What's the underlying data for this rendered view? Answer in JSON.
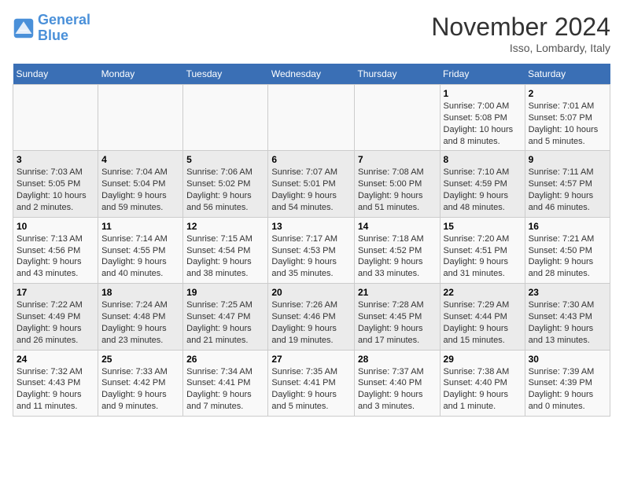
{
  "header": {
    "logo_line1": "General",
    "logo_line2": "Blue",
    "month": "November 2024",
    "location": "Isso, Lombardy, Italy"
  },
  "weekdays": [
    "Sunday",
    "Monday",
    "Tuesday",
    "Wednesday",
    "Thursday",
    "Friday",
    "Saturday"
  ],
  "weeks": [
    [
      {
        "day": "",
        "info": ""
      },
      {
        "day": "",
        "info": ""
      },
      {
        "day": "",
        "info": ""
      },
      {
        "day": "",
        "info": ""
      },
      {
        "day": "",
        "info": ""
      },
      {
        "day": "1",
        "info": "Sunrise: 7:00 AM\nSunset: 5:08 PM\nDaylight: 10 hours\nand 8 minutes."
      },
      {
        "day": "2",
        "info": "Sunrise: 7:01 AM\nSunset: 5:07 PM\nDaylight: 10 hours\nand 5 minutes."
      }
    ],
    [
      {
        "day": "3",
        "info": "Sunrise: 7:03 AM\nSunset: 5:05 PM\nDaylight: 10 hours\nand 2 minutes."
      },
      {
        "day": "4",
        "info": "Sunrise: 7:04 AM\nSunset: 5:04 PM\nDaylight: 9 hours\nand 59 minutes."
      },
      {
        "day": "5",
        "info": "Sunrise: 7:06 AM\nSunset: 5:02 PM\nDaylight: 9 hours\nand 56 minutes."
      },
      {
        "day": "6",
        "info": "Sunrise: 7:07 AM\nSunset: 5:01 PM\nDaylight: 9 hours\nand 54 minutes."
      },
      {
        "day": "7",
        "info": "Sunrise: 7:08 AM\nSunset: 5:00 PM\nDaylight: 9 hours\nand 51 minutes."
      },
      {
        "day": "8",
        "info": "Sunrise: 7:10 AM\nSunset: 4:59 PM\nDaylight: 9 hours\nand 48 minutes."
      },
      {
        "day": "9",
        "info": "Sunrise: 7:11 AM\nSunset: 4:57 PM\nDaylight: 9 hours\nand 46 minutes."
      }
    ],
    [
      {
        "day": "10",
        "info": "Sunrise: 7:13 AM\nSunset: 4:56 PM\nDaylight: 9 hours\nand 43 minutes."
      },
      {
        "day": "11",
        "info": "Sunrise: 7:14 AM\nSunset: 4:55 PM\nDaylight: 9 hours\nand 40 minutes."
      },
      {
        "day": "12",
        "info": "Sunrise: 7:15 AM\nSunset: 4:54 PM\nDaylight: 9 hours\nand 38 minutes."
      },
      {
        "day": "13",
        "info": "Sunrise: 7:17 AM\nSunset: 4:53 PM\nDaylight: 9 hours\nand 35 minutes."
      },
      {
        "day": "14",
        "info": "Sunrise: 7:18 AM\nSunset: 4:52 PM\nDaylight: 9 hours\nand 33 minutes."
      },
      {
        "day": "15",
        "info": "Sunrise: 7:20 AM\nSunset: 4:51 PM\nDaylight: 9 hours\nand 31 minutes."
      },
      {
        "day": "16",
        "info": "Sunrise: 7:21 AM\nSunset: 4:50 PM\nDaylight: 9 hours\nand 28 minutes."
      }
    ],
    [
      {
        "day": "17",
        "info": "Sunrise: 7:22 AM\nSunset: 4:49 PM\nDaylight: 9 hours\nand 26 minutes."
      },
      {
        "day": "18",
        "info": "Sunrise: 7:24 AM\nSunset: 4:48 PM\nDaylight: 9 hours\nand 23 minutes."
      },
      {
        "day": "19",
        "info": "Sunrise: 7:25 AM\nSunset: 4:47 PM\nDaylight: 9 hours\nand 21 minutes."
      },
      {
        "day": "20",
        "info": "Sunrise: 7:26 AM\nSunset: 4:46 PM\nDaylight: 9 hours\nand 19 minutes."
      },
      {
        "day": "21",
        "info": "Sunrise: 7:28 AM\nSunset: 4:45 PM\nDaylight: 9 hours\nand 17 minutes."
      },
      {
        "day": "22",
        "info": "Sunrise: 7:29 AM\nSunset: 4:44 PM\nDaylight: 9 hours\nand 15 minutes."
      },
      {
        "day": "23",
        "info": "Sunrise: 7:30 AM\nSunset: 4:43 PM\nDaylight: 9 hours\nand 13 minutes."
      }
    ],
    [
      {
        "day": "24",
        "info": "Sunrise: 7:32 AM\nSunset: 4:43 PM\nDaylight: 9 hours\nand 11 minutes."
      },
      {
        "day": "25",
        "info": "Sunrise: 7:33 AM\nSunset: 4:42 PM\nDaylight: 9 hours\nand 9 minutes."
      },
      {
        "day": "26",
        "info": "Sunrise: 7:34 AM\nSunset: 4:41 PM\nDaylight: 9 hours\nand 7 minutes."
      },
      {
        "day": "27",
        "info": "Sunrise: 7:35 AM\nSunset: 4:41 PM\nDaylight: 9 hours\nand 5 minutes."
      },
      {
        "day": "28",
        "info": "Sunrise: 7:37 AM\nSunset: 4:40 PM\nDaylight: 9 hours\nand 3 minutes."
      },
      {
        "day": "29",
        "info": "Sunrise: 7:38 AM\nSunset: 4:40 PM\nDaylight: 9 hours\nand 1 minute."
      },
      {
        "day": "30",
        "info": "Sunrise: 7:39 AM\nSunset: 4:39 PM\nDaylight: 9 hours\nand 0 minutes."
      }
    ]
  ]
}
